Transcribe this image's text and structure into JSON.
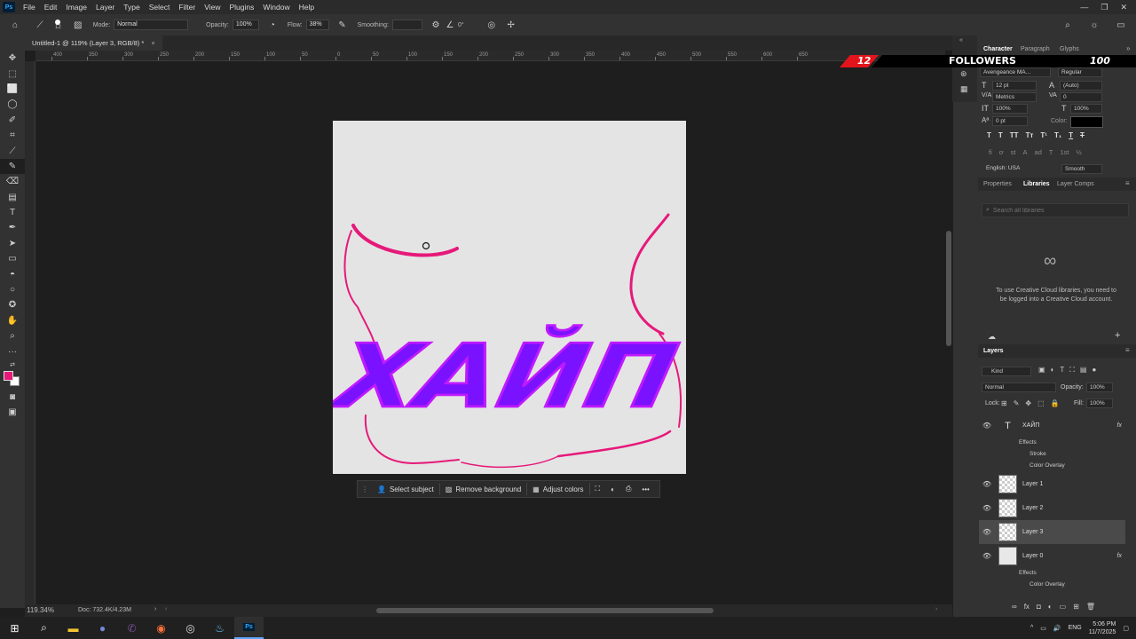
{
  "menu": {
    "logo": "Ps",
    "items": [
      "File",
      "Edit",
      "Image",
      "Layer",
      "Type",
      "Select",
      "Filter",
      "View",
      "Plugins",
      "Window",
      "Help"
    ]
  },
  "options": {
    "brush_size": "12",
    "mode_label": "Mode:",
    "mode_value": "Normal",
    "opacity_label": "Opacity:",
    "opacity_value": "100%",
    "flow_label": "Flow:",
    "flow_value": "38%",
    "smoothing_label": "Smoothing:",
    "smoothing_value": "",
    "angle_value": "0°"
  },
  "document": {
    "tab_title": "Untitled-1 @ 119% (Layer 3, RGB/8) *",
    "close": "×"
  },
  "ruler_labels": [
    "400",
    "350",
    "300",
    "250",
    "200",
    "150",
    "100",
    "50",
    "0",
    "50",
    "100",
    "150",
    "200",
    "250",
    "300",
    "350",
    "400",
    "450",
    "500",
    "550",
    "600",
    "650"
  ],
  "artwork": {
    "text": "ХАЙП",
    "text_color": "#7a12ff",
    "stroke_color": "#c01aff",
    "line_color": "#e6197a"
  },
  "context_bar": {
    "select_subject": "Select subject",
    "remove_background": "Remove background",
    "adjust_colors": "Adjust colors",
    "more": "•••"
  },
  "status": {
    "zoom": "119.34%",
    "doc": "Doc: 732.4K/4.23M"
  },
  "followers": {
    "count_left": "12",
    "label": "FOLLOWERS",
    "count_right": "100"
  },
  "character_panel": {
    "tabs": [
      "Character",
      "Paragraph",
      "Glyphs"
    ],
    "font_family": "Avengeance MA...",
    "font_style": "Regular",
    "size": "12 pt",
    "leading": "(Auto)",
    "kerning": "Metrics",
    "tracking": "0",
    "vscale": "100%",
    "hscale": "100%",
    "baseline": "0 pt",
    "color_label": "Color:",
    "style_buttons": [
      "T",
      "T",
      "TT",
      "Tт",
      "T¹",
      "T₁",
      "T",
      "T"
    ],
    "opentype_buttons": [
      "fi",
      "ơ",
      "st",
      "A",
      "ad",
      "T",
      "1st",
      "½"
    ],
    "language": "English: USA",
    "antialias": "Smooth"
  },
  "libraries_panel": {
    "tabs": [
      "Properties",
      "Libraries",
      "Layer Comps"
    ],
    "search_placeholder": "Search all libraries",
    "message": "To use Creative Cloud libraries, you need to be logged into a Creative Cloud account."
  },
  "layers_panel": {
    "title": "Layers",
    "kind": "Kind",
    "blend": "Normal",
    "opacity_label": "Opacity:",
    "opacity": "100%",
    "lock_label": "Lock:",
    "fill_label": "Fill:",
    "fill": "100%",
    "text_layer": "ХАЙП",
    "effects": "Effects",
    "stroke": "Stroke",
    "color_overlay": "Color Overlay",
    "layer1": "Layer 1",
    "layer2": "Layer 2",
    "layer3": "Layer 3",
    "layer0": "Layer 0",
    "effects2": "Effects",
    "color_overlay2": "Color Overlay",
    "fx": "fx"
  },
  "taskbar": {
    "lang": "ENG",
    "time": "5:06 PM",
    "date": "11/7/2025"
  }
}
